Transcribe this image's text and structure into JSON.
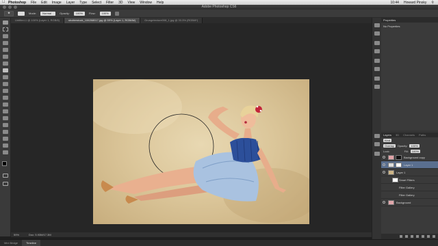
{
  "menubar": {
    "app": "Photoshop",
    "items": [
      "File",
      "Edit",
      "Image",
      "Layer",
      "Type",
      "Select",
      "Filter",
      "3D",
      "View",
      "Window",
      "Help"
    ],
    "clock": "10:44",
    "user": "Howard Pinsky"
  },
  "titlebar": {
    "title": "Adobe Photoshop CS6"
  },
  "options": {
    "mode_label": "Mode:",
    "mode_value": "Normal",
    "opacity_label": "Opacity:",
    "opacity_value": "100%",
    "flow_label": "Flow:",
    "flow_value": "100%"
  },
  "tabs": [
    {
      "label": "Untitled-1 @ 100% (Layer 1, RGB/8)"
    },
    {
      "label": "shutterstock_106268017.jpg @ 59% (Layer 1, RGB/8#)"
    },
    {
      "label": "Grungetexture008_1.jpg @ 33.3% (RGB/8*)"
    }
  ],
  "status": {
    "zoom": "59%",
    "doc": "Doc: 5.93M/17.3M"
  },
  "bottom_tabs": [
    "Mini Bridge",
    "Timeline"
  ],
  "properties": {
    "title": "Properties",
    "empty": "No Properties"
  },
  "layers_panel": {
    "tabs": [
      "Layers",
      "3D",
      "Channels",
      "Paths"
    ],
    "kind_label": "Kind",
    "blend": "Overlay",
    "opacity_label": "Opacity:",
    "opacity_value": "100%",
    "lock_label": "Lock:",
    "fill_label": "Fill:",
    "fill_value": "100%",
    "layers": [
      {
        "name": "Background copy"
      },
      {
        "name": "Layer 1"
      },
      {
        "name": "Layer 1"
      },
      {
        "name": "Smart Filters"
      },
      {
        "name": "Filter Gallery"
      },
      {
        "name": "Filter Gallery"
      },
      {
        "name": "Background"
      }
    ]
  }
}
